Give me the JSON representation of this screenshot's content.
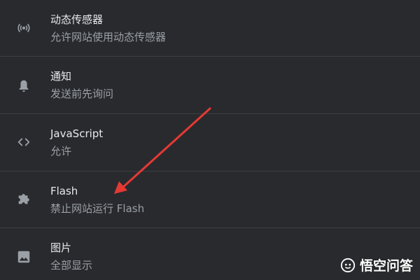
{
  "settings": {
    "items": [
      {
        "icon": "sensors-icon",
        "title": "动态传感器",
        "subtitle": "允许网站使用动态传感器"
      },
      {
        "icon": "bell-icon",
        "title": "通知",
        "subtitle": "发送前先询问"
      },
      {
        "icon": "code-icon",
        "title": "JavaScript",
        "subtitle": "允许"
      },
      {
        "icon": "puzzle-icon",
        "title": "Flash",
        "subtitle": "禁止网站运行 Flash"
      },
      {
        "icon": "image-icon",
        "title": "图片",
        "subtitle": "全部显示"
      }
    ]
  },
  "annotation": {
    "color": "#e53935"
  },
  "watermark": {
    "text": "悟空问答"
  },
  "colors": {
    "background": "#292a2d",
    "title": "#e8eaed",
    "subtitle": "#9aa0a6",
    "icon": "#9aa0a6",
    "divider": "#3c4043"
  }
}
